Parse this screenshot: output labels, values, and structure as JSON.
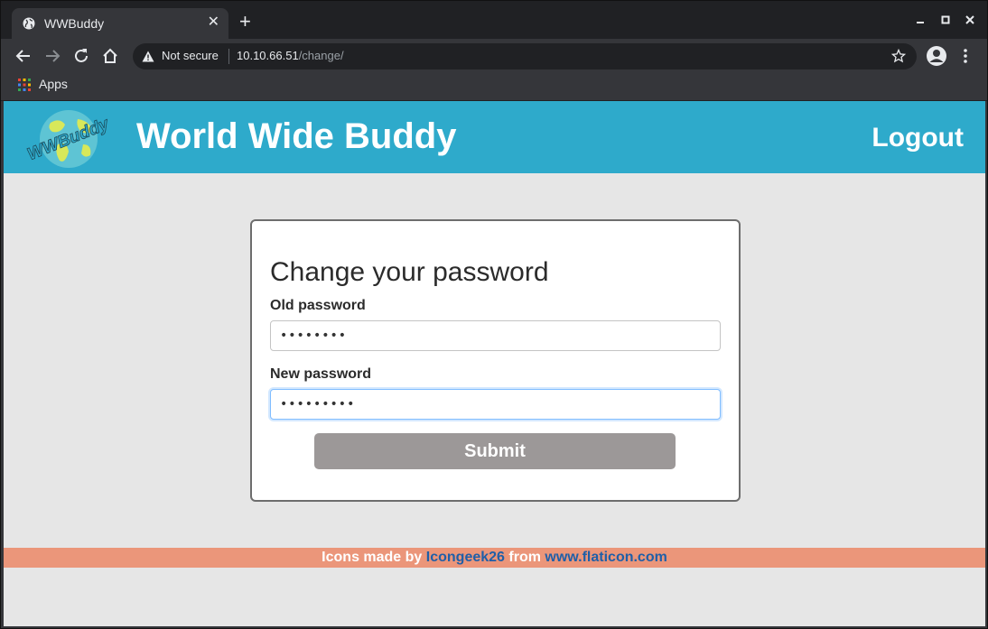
{
  "browser": {
    "tab_title": "WWBuddy",
    "new_tab_symbol": "+",
    "tab_close_symbol": "✕",
    "security_label": "Not secure",
    "url_host": "10.10.66.51",
    "url_path": "/change/",
    "bookmarks_apps_label": "Apps",
    "icons": [
      "globe-icon",
      "back-icon",
      "forward-icon",
      "reload-icon",
      "home-icon",
      "warning-icon",
      "star-icon",
      "profile-icon",
      "menu-icon",
      "apps-icon",
      "minimize-icon",
      "maximize-icon",
      "close-icon"
    ]
  },
  "site": {
    "logo_text": "WWBuddy",
    "title": "World Wide Buddy",
    "logout_label": "Logout",
    "header_color": "#2eaacb"
  },
  "form": {
    "title": "Change your password",
    "old_password_label": "Old password",
    "old_password_value": "••••••••",
    "new_password_label": "New password",
    "new_password_value": "•••••••••",
    "submit_label": "Submit"
  },
  "footer": {
    "prefix": "Icons made by",
    "author_link": "Icongeek26",
    "middle": "from",
    "source_link": "www.flaticon.com",
    "color": "#eb967a"
  }
}
